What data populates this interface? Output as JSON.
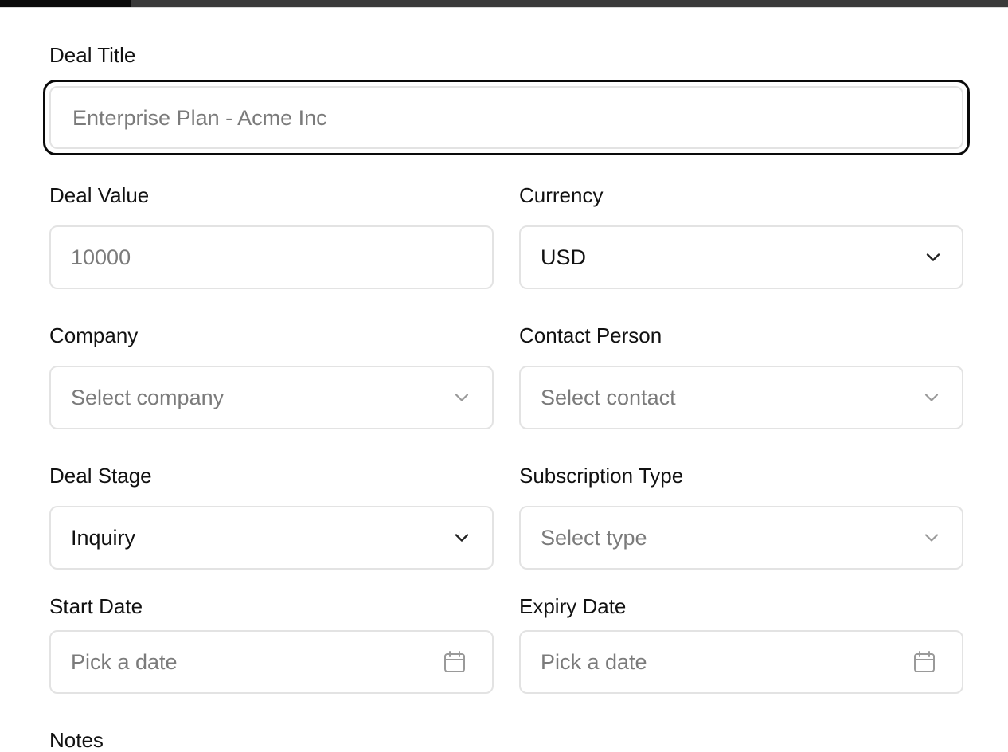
{
  "form": {
    "deal_title": {
      "label": "Deal Title",
      "placeholder": "Enterprise Plan - Acme Inc"
    },
    "deal_value": {
      "label": "Deal Value",
      "placeholder": "10000"
    },
    "currency": {
      "label": "Currency",
      "value": "USD"
    },
    "company": {
      "label": "Company",
      "placeholder": "Select company"
    },
    "contact_person": {
      "label": "Contact Person",
      "placeholder": "Select contact"
    },
    "deal_stage": {
      "label": "Deal Stage",
      "value": "Inquiry"
    },
    "subscription_type": {
      "label": "Subscription Type",
      "placeholder": "Select type"
    },
    "start_date": {
      "label": "Start Date",
      "placeholder": "Pick a date"
    },
    "expiry_date": {
      "label": "Expiry Date",
      "placeholder": "Pick a date"
    },
    "notes": {
      "label": "Notes"
    }
  },
  "icons": {
    "dropdown": "chevron-down-icon",
    "date": "calendar-icon"
  },
  "colors": {
    "border": "#e3e3e3",
    "focus": "#0a0a0a",
    "placeholder": "#7b7b7b",
    "text": "#111111"
  },
  "top_progress": 0.13
}
